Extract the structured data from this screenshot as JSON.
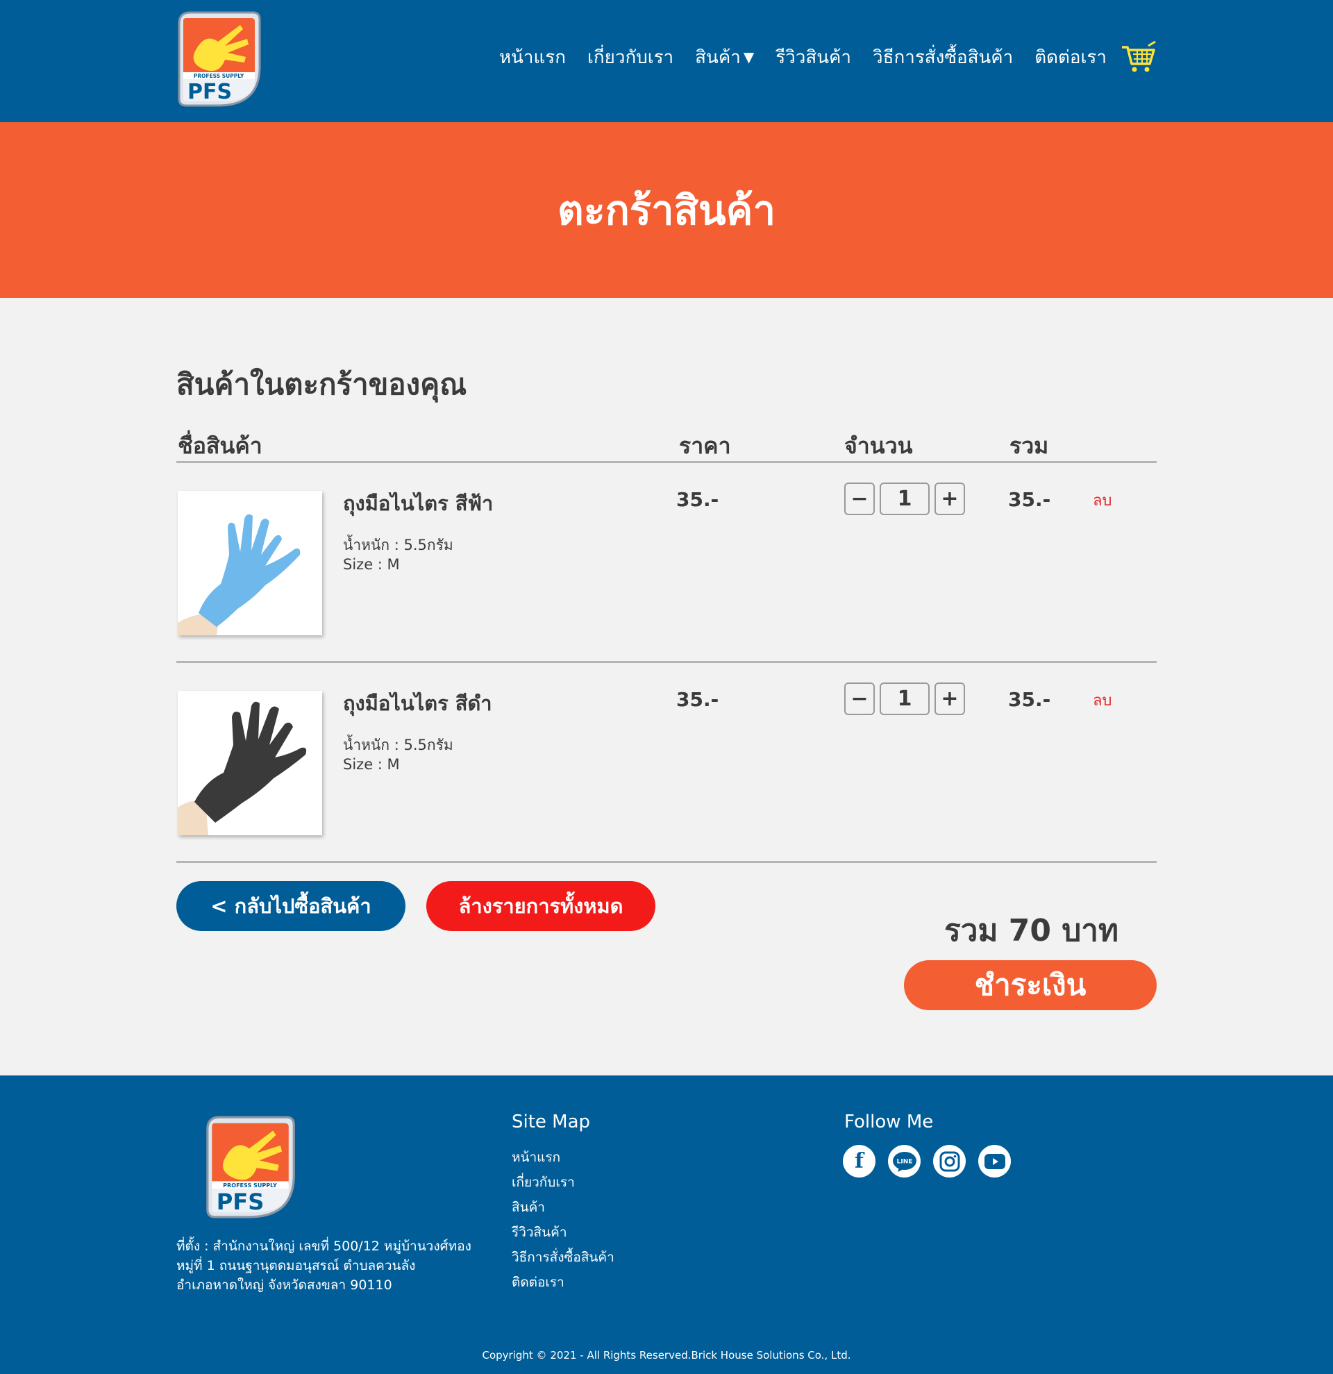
{
  "header": {
    "logo_text": "PFS",
    "logo_sub": "PROFESS SUPPLY",
    "nav": [
      "หน้าแรก",
      "เกี่ยวกับเรา",
      "สินค้า",
      "รีวิวสินค้า",
      "วิธีการสั่งซื้อสินค้า",
      "ติดต่อเรา"
    ],
    "dropdown_caret": "▼",
    "cart_icon": "shopping-cart-icon"
  },
  "banner": {
    "title": "ตะกร้าสินค้า"
  },
  "cart": {
    "section_title": "สินค้าในตะกร้าของคุณ",
    "columns": {
      "name": "ชื่อสินค้า",
      "price": "ราคา",
      "qty": "จำนวน",
      "total": "รวม"
    },
    "items": [
      {
        "name": "ถุงมือไนไตร สีฟ้า",
        "weight": "น้ำหนัก : 5.5กรัม",
        "size": "Size : M",
        "price": "35.-",
        "qty": "1",
        "total": "35.-",
        "remove": "ลบ",
        "glove_color": "#6fb8ec"
      },
      {
        "name": "ถุงมือไนไตร สีดำ",
        "weight": "น้ำหนัก : 5.5กรัม",
        "size": "Size : M",
        "price": "35.-",
        "qty": "1",
        "total": "35.-",
        "remove": "ลบ",
        "glove_color": "#3a3a3a"
      }
    ],
    "minus": "−",
    "plus": "+",
    "back_button": "< กลับไปซื้อสินค้า",
    "clear_button": "ล้างรายการทั้งหมด",
    "grand_total": "รวม 70 บาท",
    "pay_button": "ชำระเงิน"
  },
  "footer": {
    "address": [
      "ที่ตั้ง : สำนักงานใหญ่ เลขที่ 500/12 หมู่บ้านวงศ์ทอง",
      "หมู่ที่ 1 ถนนฐานุตดมอนุสรณ์ ตำบลควนลัง",
      "อำเภอหาดใหญ่ จังหวัดสงขลา 90110"
    ],
    "sitemap_title": "Site Map",
    "sitemap": [
      "หน้าแรก",
      "เกี่ยวกับเรา",
      "สินค้า",
      "รีวิวสินค้า",
      "วิธีการสั่งซื้อสินค้า",
      "ติดต่อเรา"
    ],
    "follow_title": "Follow Me",
    "social_icons": [
      "facebook-icon",
      "line-icon",
      "instagram-icon",
      "youtube-icon"
    ],
    "line_text": "LINE",
    "facebook_glyph": "f",
    "copyright": "Copyright © 2021 -  All Rights Reserved.Brick House Solutions Co., Ltd."
  },
  "colors": {
    "primary": "#005d98",
    "accent": "#f35e33",
    "danger": "#f31a1a",
    "background": "#f2f2f2"
  }
}
